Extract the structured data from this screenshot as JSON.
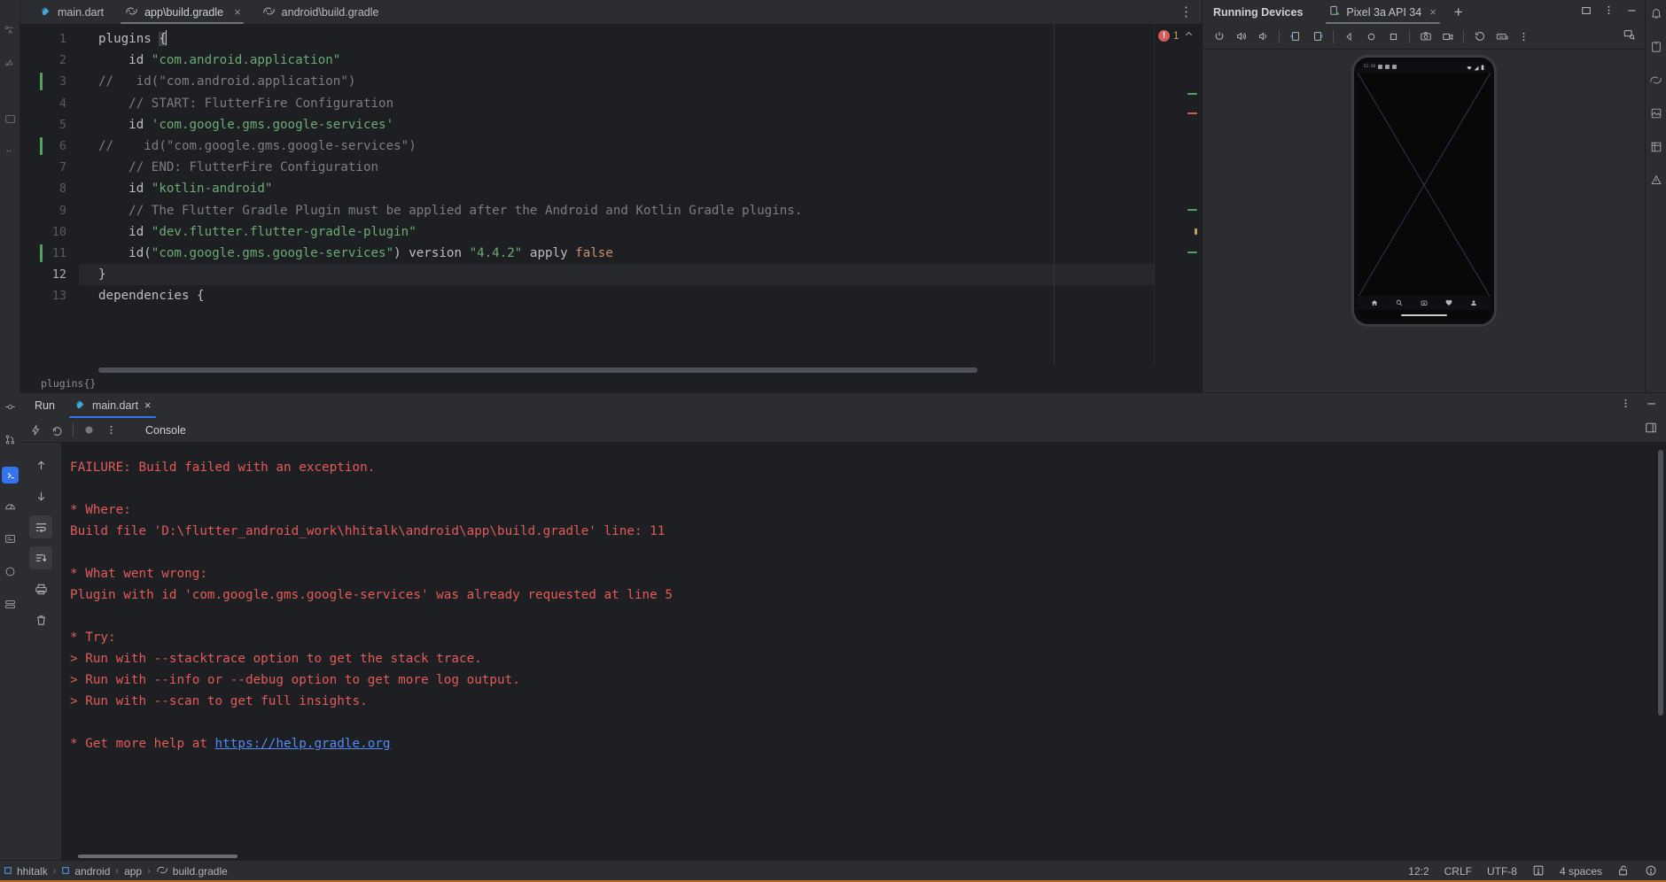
{
  "editor": {
    "tabs": [
      {
        "label": "main.dart",
        "icon": "dart-file-icon",
        "active": false,
        "closable": false
      },
      {
        "label": "app\\build.gradle",
        "icon": "gradle-file-icon",
        "active": true,
        "closable": true
      },
      {
        "label": "android\\build.gradle",
        "icon": "gradle-file-icon",
        "active": false,
        "closable": false
      }
    ],
    "kebab_label": "⋮",
    "error_count": "1",
    "error_glyph": "!",
    "breadcrumb": "plugins{}",
    "lines": [
      {
        "num": "1",
        "changed": false,
        "current": false,
        "tokens": [
          {
            "t": "plugins ",
            "c": "def"
          },
          {
            "t": "{",
            "c": "brace"
          }
        ]
      },
      {
        "num": "2",
        "changed": false,
        "current": false,
        "tokens": [
          {
            "t": "    id ",
            "c": "def"
          },
          {
            "t": "\"com.android.application\"",
            "c": "str"
          }
        ]
      },
      {
        "num": "3",
        "changed": true,
        "current": false,
        "tokens": [
          {
            "t": "//   id(\"com.android.application\")",
            "c": "com"
          }
        ]
      },
      {
        "num": "4",
        "changed": false,
        "current": false,
        "tokens": [
          {
            "t": "    // START: FlutterFire Configuration",
            "c": "com"
          }
        ]
      },
      {
        "num": "5",
        "changed": false,
        "current": false,
        "tokens": [
          {
            "t": "    id ",
            "c": "def"
          },
          {
            "t": "'com.google.gms.google-services'",
            "c": "str"
          }
        ]
      },
      {
        "num": "6",
        "changed": true,
        "current": false,
        "tokens": [
          {
            "t": "//    id(\"com.google.gms.google-services\")",
            "c": "com"
          }
        ]
      },
      {
        "num": "7",
        "changed": false,
        "current": false,
        "tokens": [
          {
            "t": "    // END: FlutterFire Configuration",
            "c": "com"
          }
        ]
      },
      {
        "num": "8",
        "changed": false,
        "current": false,
        "tokens": [
          {
            "t": "    id ",
            "c": "def"
          },
          {
            "t": "\"kotlin-android\"",
            "c": "str"
          }
        ]
      },
      {
        "num": "9",
        "changed": false,
        "current": false,
        "tokens": [
          {
            "t": "    // The Flutter Gradle Plugin must be applied after the Android and Kotlin Gradle plugins.",
            "c": "com"
          }
        ]
      },
      {
        "num": "10",
        "changed": false,
        "current": false,
        "tokens": [
          {
            "t": "    id ",
            "c": "def"
          },
          {
            "t": "\"dev.flutter.flutter-gradle-plugin\"",
            "c": "str"
          }
        ]
      },
      {
        "num": "11",
        "changed": true,
        "current": false,
        "tokens": [
          {
            "t": "    id(",
            "c": "def"
          },
          {
            "t": "\"com.google.gms.google-services\"",
            "c": "str"
          },
          {
            "t": ") version ",
            "c": "def"
          },
          {
            "t": "\"4.4.2\"",
            "c": "str"
          },
          {
            "t": " apply ",
            "c": "def"
          },
          {
            "t": "false",
            "c": "kw"
          }
        ]
      },
      {
        "num": "12",
        "changed": false,
        "current": true,
        "tokens": [
          {
            "t": "}",
            "c": "def"
          }
        ]
      },
      {
        "num": "13",
        "changed": false,
        "current": false,
        "tokens": [
          {
            "t": "dependencies ",
            "c": "def"
          },
          {
            "t": "{",
            "c": "def"
          }
        ]
      }
    ]
  },
  "devices": {
    "title": "Running Devices",
    "tab_label": "Pixel 3a API 34",
    "tab_close": "×",
    "add_tab": "+",
    "header_icons": [
      "restore-window-icon",
      "options-kebab-icon",
      "minimize-icon"
    ],
    "toolbar_icons": [
      "power-icon",
      "volume-up-icon",
      "volume-down-icon",
      "rotate-left-icon",
      "rotate-right-icon",
      "back-nav-icon",
      "home-nav-icon",
      "overview-nav-icon",
      "screenshot-icon",
      "record-video-icon",
      "history-rewind-icon",
      "keyboard-icon",
      "more-kebab-icon"
    ],
    "toolbar_right_icon": "device-frame-icon",
    "phone": {
      "status_time": "12:20",
      "status_left_icons": [
        "message-icon",
        "clock-icon",
        "battery-alert-icon",
        "square-app-icon"
      ],
      "status_right_icons": [
        "wifi-icon",
        "signal-icon",
        "battery-icon"
      ],
      "nav_icons": [
        "home-icon",
        "search-icon",
        "camera-icon",
        "heart-icon",
        "person-icon"
      ]
    }
  },
  "run": {
    "panel_label": "Run",
    "tab_label": "main.dart",
    "tab_close": "×",
    "tab_icon": "flutter-icon",
    "console_label": "Console",
    "toolbar_icons": [
      "rerun-bolt-icon",
      "restart-icon",
      "stop-icon",
      "more-kebab-icon"
    ],
    "toolbar_right_icon": "layout-split-icon",
    "side_icons": [
      "scroll-up-icon",
      "scroll-down-icon",
      "soft-wrap-icon",
      "scroll-to-end-icon",
      "print-icon",
      "clear-all-icon"
    ],
    "header_right_icons": [
      "more-kebab-icon",
      "minimize-icon"
    ],
    "console_lines": [
      {
        "text": "FAILURE: Build failed with an exception.",
        "link": null
      },
      {
        "text": "",
        "link": null
      },
      {
        "text": "* Where:",
        "link": null
      },
      {
        "text": "Build file 'D:\\flutter_android_work\\hhitalk\\android\\app\\build.gradle' line: 11",
        "link": null
      },
      {
        "text": "",
        "link": null
      },
      {
        "text": "* What went wrong:",
        "link": null
      },
      {
        "text": "Plugin with id 'com.google.gms.google-services' was already requested at line 5",
        "link": null
      },
      {
        "text": "",
        "link": null
      },
      {
        "text": "* Try:",
        "link": null
      },
      {
        "text": "> Run with --stacktrace option to get the stack trace.",
        "link": null
      },
      {
        "text": "> Run with --info or --debug option to get more log output.",
        "link": null
      },
      {
        "text": "> Run with --scan to get full insights.",
        "link": null
      },
      {
        "text": "",
        "link": null
      },
      {
        "text": "* Get more help at ",
        "link": "https://help.gradle.org"
      }
    ]
  },
  "status_bar": {
    "breadcrumbs": [
      {
        "label": "hhitalk",
        "icon": "project-module-icon"
      },
      {
        "label": "android",
        "icon": "folder-module-icon"
      },
      {
        "label": "app",
        "icon": null
      },
      {
        "label": "build.gradle",
        "icon": "gradle-file-icon"
      }
    ],
    "separator": "›",
    "caret_position": "12:2",
    "line_separator": "CRLF",
    "encoding": "UTF-8",
    "inspection_icon": "inspection-widget-icon",
    "indent": "4 spaces",
    "lock_icon": "unlocked-padlock-icon",
    "notification_icon": "warning-circle-icon"
  },
  "colors": {
    "background": "#1e1f22",
    "panel": "#2b2d30",
    "accent_blue": "#3574f0",
    "error_red": "#e35a5a",
    "string_green": "#6aab73",
    "comment_gray": "#7a7e85",
    "keyword_orange": "#cf8e6d",
    "link_blue": "#548af7",
    "changed_green": "#55a362"
  }
}
